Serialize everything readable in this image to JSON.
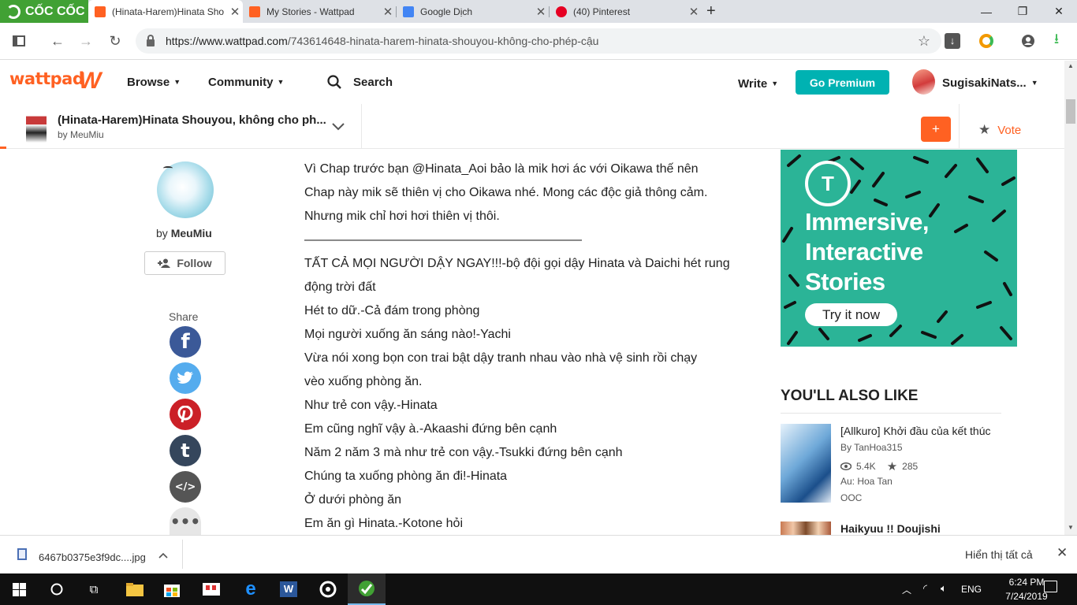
{
  "browser": {
    "brand": "CỐC CỐC",
    "tabs": [
      {
        "title": "(Hinata-Harem)Hinata Sho",
        "active": true
      },
      {
        "title": "My Stories - Wattpad",
        "active": false
      },
      {
        "title": "Google Dịch",
        "active": false
      },
      {
        "title": "(40) Pinterest",
        "active": false
      }
    ],
    "url_host": "https://www.wattpad.com",
    "url_path": "/743614648-hinata-harem-hinata-shouyou-không-cho-phép-cậu"
  },
  "header": {
    "logo": "wattpad",
    "nav": [
      "Browse",
      "Community"
    ],
    "search_label": "Search",
    "write_label": "Write",
    "premium_label": "Go Premium",
    "username": "SugisakiNats..."
  },
  "storybar": {
    "title": "(Hinata-Harem)Hinata Shouyou, không cho ph...",
    "by": "by MeuMiu",
    "add_label": "+",
    "vote_label": "Vote"
  },
  "author": {
    "by_prefix": "by",
    "name": "MeuMiu",
    "follow_label": "Follow",
    "share_label": "Share"
  },
  "story_lines": [
    "Vì Chap trước bạn @Hinata_Aoi bảo là mik hơi ác với Oikawa thế nên",
    "Chap này mik sẽ thiên vị cho Oikawa nhé. Mong các độc giả thông cảm.",
    "Nhưng mik chỉ hơi hơi thiên vị thôi.",
    "——————————————————————",
    "TẤT CẢ MỌI NGƯỜI DẬY NGAY!!!-bộ đội gọi dậy Hinata và Daichi hét rung",
    "động trời đất",
    "Hét to dữ.-Cả đám trong phòng",
    "Mọi người xuống ăn sáng nào!-Yachi",
    "Vừa nói xong bọn con trai bật dậy tranh nhau vào nhà vệ sinh rồi chạy",
    "vèo xuống phòng ăn.",
    "Như trẻ con vậy.-Hinata",
    "Em cũng nghĩ vậy à.-Akaashi đứng bên cạnh",
    "Năm 2 năm 3 mà như trẻ con vậy.-Tsukki đứng bên cạnh",
    "Chúng ta xuống phòng ăn đi!-Hinata",
    "Ở dưới phòng ăn",
    "Em ăn gì Hinata.-Kotone hỏi"
  ],
  "ad": {
    "logo_letter": "T",
    "line1": "Immersive,",
    "line2": "Interactive",
    "line3": "Stories",
    "cta": "Try it now"
  },
  "also_like": {
    "heading": "YOU'LL ALSO LIKE",
    "items": [
      {
        "title": "[Allkuro] Khởi đầu của kết thúc",
        "by": "By TanHoa315",
        "reads": "5.4K",
        "votes": "285",
        "tags": [
          "Au: Hoa Tan",
          "OOC"
        ]
      },
      {
        "title": "Haikyuu !! Doujishi"
      }
    ]
  },
  "download": {
    "filename": "6467b0375e3f9dc....jpg",
    "show_all": "Hiển thị tất cả"
  },
  "taskbar": {
    "lang": "ENG",
    "time": "6:24 PM",
    "date": "7/24/2019"
  },
  "colors": {
    "wattpad_orange": "#ff6122",
    "premium_teal": "#00b2b2",
    "coccoc_green": "#41a134",
    "ad_green": "#2bb497"
  }
}
